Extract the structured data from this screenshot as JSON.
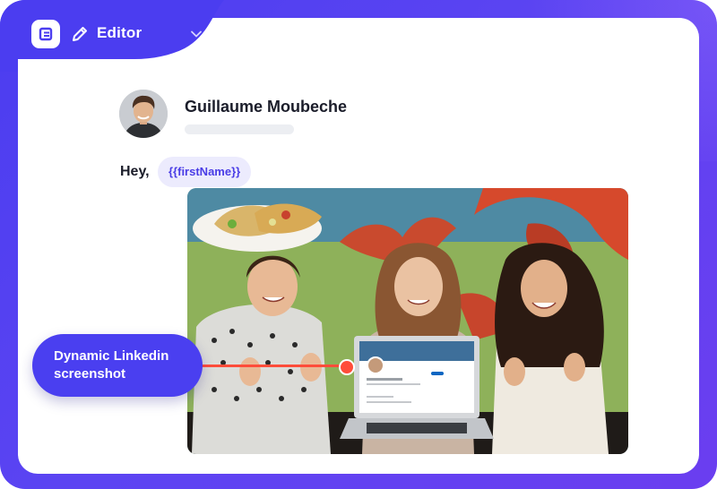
{
  "header": {
    "logo_icon": "app-logo-icon",
    "edit_icon": "pencil-icon",
    "label": "Editor",
    "dropdown_icon": "chevron-down-icon"
  },
  "message": {
    "sender_name": "Guillaume Moubeche",
    "greeting": "Hey,",
    "variable": "{{firstName}}"
  },
  "media": {
    "callout_label": "Dynamic Linkedin screenshot"
  },
  "colors": {
    "brand": "#4b3df0",
    "chip_bg": "#ecebfd",
    "chip_text": "#4a3de6",
    "connector": "#ff4d3a"
  }
}
